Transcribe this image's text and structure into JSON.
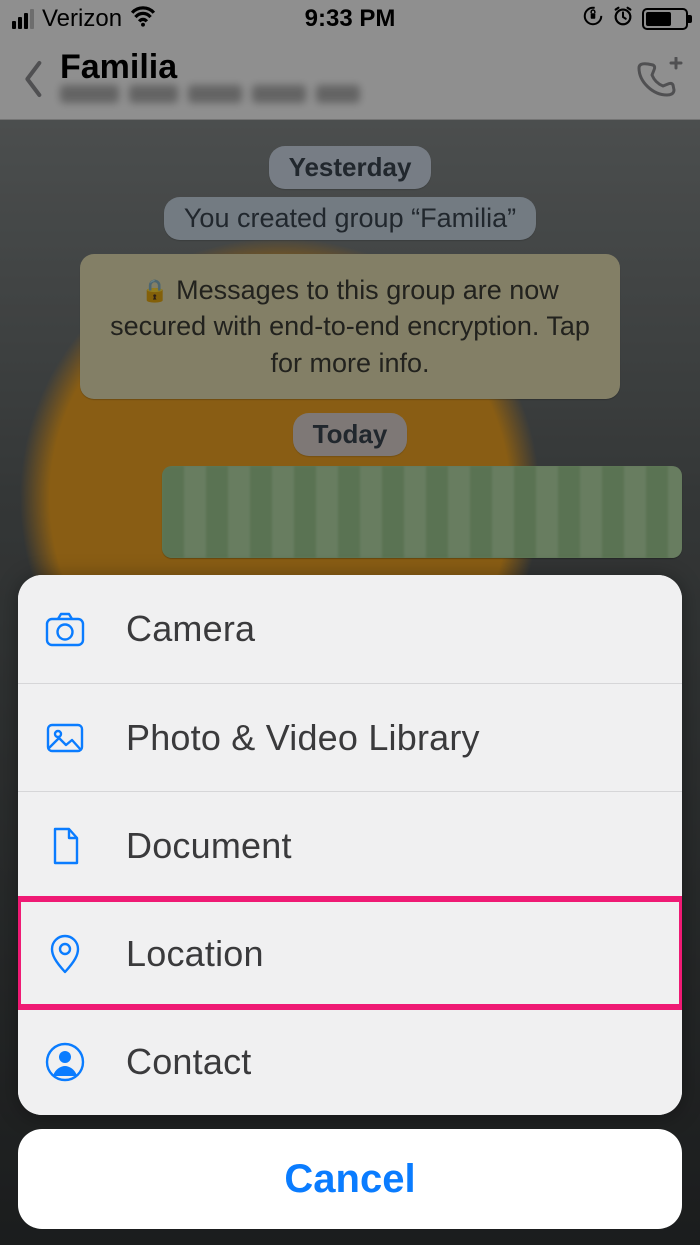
{
  "status": {
    "carrier": "Verizon",
    "time": "9:33 PM"
  },
  "header": {
    "chat_title": "Familia"
  },
  "chat": {
    "date1": "Yesterday",
    "system1": "You created group “Familia”",
    "encryption": "Messages to this group are now secured with end-to-end encryption. Tap for more info.",
    "date2": "Today"
  },
  "sheet": {
    "items": [
      {
        "icon": "camera-icon",
        "label": "Camera"
      },
      {
        "icon": "photo-icon",
        "label": "Photo & Video Library"
      },
      {
        "icon": "document-icon",
        "label": "Document"
      },
      {
        "icon": "location-icon",
        "label": "Location"
      },
      {
        "icon": "contact-icon",
        "label": "Contact"
      }
    ],
    "cancel": "Cancel",
    "highlighted_index": 3
  }
}
